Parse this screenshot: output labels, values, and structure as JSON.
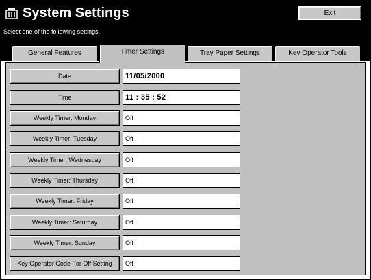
{
  "window": {
    "title": "System Settings",
    "exit_label": "Exit"
  },
  "instruction": "Select one of the following settings.",
  "tabs": [
    {
      "label": "General Features",
      "active": false
    },
    {
      "label": "Timer Settings",
      "active": true
    },
    {
      "label": "Tray Paper Settings",
      "active": false
    },
    {
      "label": "Key Operator Tools",
      "active": false
    }
  ],
  "settings": [
    {
      "label": "Date",
      "value": "11/05/2000"
    },
    {
      "label": "Time",
      "value": "11 : 35 : 52"
    },
    {
      "label": "Weekly Timer: Monday",
      "value": "Off"
    },
    {
      "label": "Weekly Timer: Tuesday",
      "value": "Off"
    },
    {
      "label": "Weekly Timer: Wednesday",
      "value": "Off"
    },
    {
      "label": "Weekly Timer: Thursday",
      "value": "Off"
    },
    {
      "label": "Weekly Timer: Friday",
      "value": "Off"
    },
    {
      "label": "Weekly Timer: Saturday",
      "value": "Off"
    },
    {
      "label": "Weekly Timer: Sunday",
      "value": "Off"
    },
    {
      "label": "Key Operator Code For Off Setting",
      "value": "Off"
    }
  ],
  "icons": {
    "title_icon": "settings-tools-icon"
  }
}
